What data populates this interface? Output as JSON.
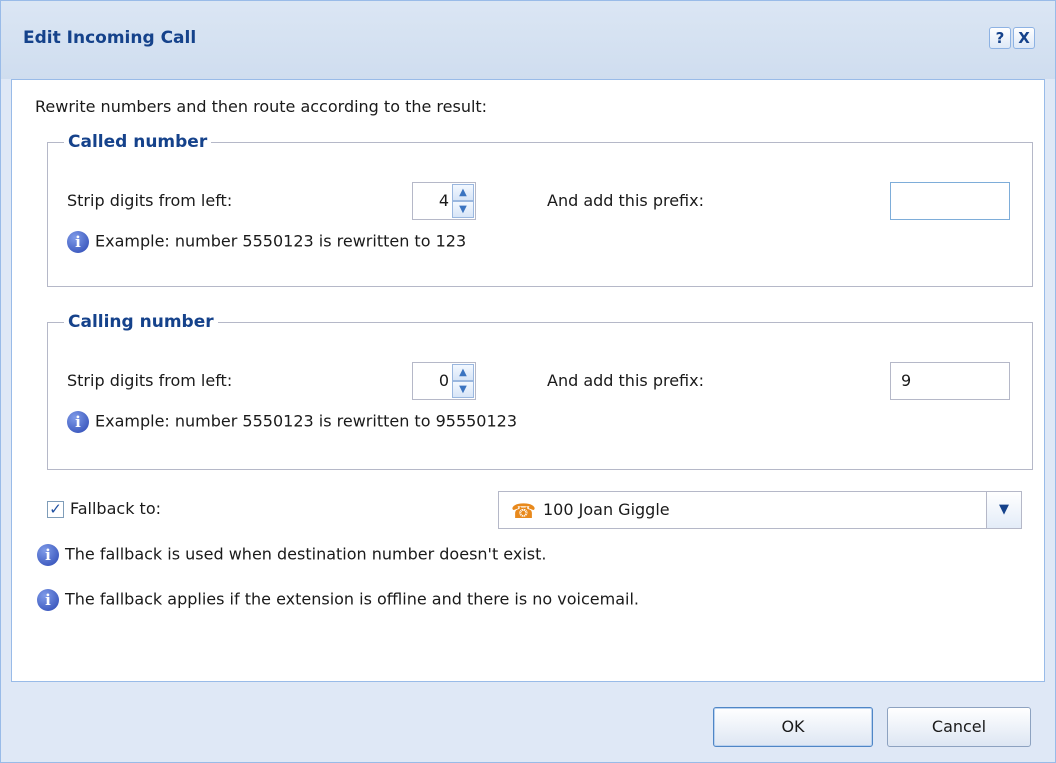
{
  "dialog": {
    "title": "Edit Incoming Call",
    "help_label": "?",
    "close_label": "X"
  },
  "intro": "Rewrite numbers and then route according to the result:",
  "called": {
    "legend": "Called number",
    "strip_label": "Strip digits from left:",
    "strip_value": "4",
    "prefix_label": "And add this prefix:",
    "prefix_value": "",
    "example": "Example: number 5550123 is rewritten to 123"
  },
  "calling": {
    "legend": "Calling number",
    "strip_label": "Strip digits from left:",
    "strip_value": "0",
    "prefix_label": "And add this prefix:",
    "prefix_value": "9",
    "example": "Example: number 5550123 is rewritten to 95550123"
  },
  "fallback": {
    "checked": true,
    "label": "Fallback to:",
    "selected": "100 Joan Giggle",
    "icon": "phone-icon",
    "info_1": "The fallback is used when destination number doesn't exist.",
    "info_2": "The fallback applies if the extension is offline and there is no voicemail."
  },
  "buttons": {
    "ok": "OK",
    "cancel": "Cancel"
  },
  "colors": {
    "title": "#15428b",
    "frame": "#dfe8f6",
    "border": "#99bbe8",
    "phone": "#e8891c"
  }
}
